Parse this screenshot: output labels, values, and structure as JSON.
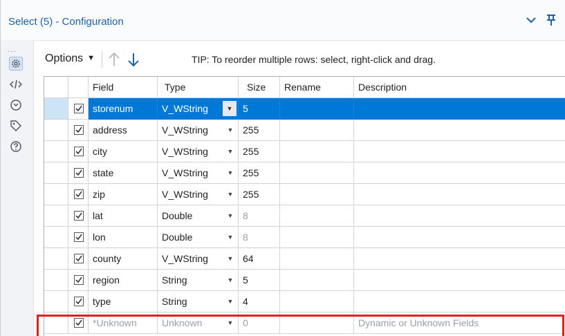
{
  "window": {
    "title": "Select (5) - Configuration",
    "collapse_icon": "chevron-down-icon",
    "pin_icon": "pin-icon"
  },
  "left_rail": {
    "more_label": "...",
    "icons": [
      "gear-icon",
      "code-icon",
      "tool-tab-icon",
      "tag-icon",
      "help-icon"
    ]
  },
  "toolbar": {
    "options_label": "Options",
    "tip": "TIP: To reorder multiple rows: select, right-click and drag."
  },
  "grid": {
    "headers": {
      "field": "Field",
      "type": "Type",
      "size": "Size",
      "rename": "Rename",
      "description": "Description"
    },
    "rows": [
      {
        "checked": true,
        "field": "storenum",
        "type": "V_WString",
        "size": "5",
        "rename": "",
        "description": "",
        "selected": true
      },
      {
        "checked": true,
        "field": "address",
        "type": "V_WString",
        "size": "255",
        "rename": "",
        "description": ""
      },
      {
        "checked": true,
        "field": "city",
        "type": "V_WString",
        "size": "255",
        "rename": "",
        "description": ""
      },
      {
        "checked": true,
        "field": "state",
        "type": "V_WString",
        "size": "255",
        "rename": "",
        "description": ""
      },
      {
        "checked": true,
        "field": "zip",
        "type": "V_WString",
        "size": "255",
        "rename": "",
        "description": ""
      },
      {
        "checked": true,
        "field": "lat",
        "type": "Double",
        "size": "8",
        "rename": "",
        "description": "",
        "size_muted": true
      },
      {
        "checked": true,
        "field": "lon",
        "type": "Double",
        "size": "8",
        "rename": "",
        "description": "",
        "size_muted": true
      },
      {
        "checked": true,
        "field": "county",
        "type": "V_WString",
        "size": "64",
        "rename": "",
        "description": ""
      },
      {
        "checked": true,
        "field": "region",
        "type": "String",
        "size": "5",
        "rename": "",
        "description": ""
      },
      {
        "checked": true,
        "field": "type",
        "type": "String",
        "size": "4",
        "rename": "",
        "description": ""
      },
      {
        "checked": true,
        "field": "*Unknown",
        "type": "Unknown",
        "size": "0",
        "rename": "",
        "description": "Dynamic or Unknown Fields",
        "muted": true
      }
    ]
  },
  "colors": {
    "title": "#1f5fa6",
    "selection": "#0078d7",
    "highlight_box": "#e0201f"
  }
}
